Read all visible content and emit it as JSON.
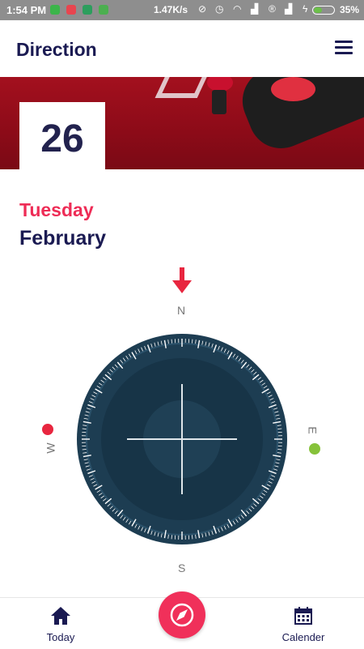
{
  "status_bar": {
    "time": "1:54 PM",
    "speed": "1.47K/s",
    "battery_percent": "35%"
  },
  "app_bar": {
    "title": "Direction",
    "menu_icon": "hamburger-menu-icon"
  },
  "date": {
    "day_number": "26",
    "weekday": "Tuesday",
    "month": "February"
  },
  "compass": {
    "north": "N",
    "south": "S",
    "east": "E",
    "west": "W",
    "colors": {
      "arrow": "#e8263f",
      "west_dot": "#e8263f",
      "east_dot": "#86c23a",
      "dial": "#1d3d52",
      "dial_inner": "#183345"
    }
  },
  "bottom_nav": {
    "today_label": "Today",
    "calendar_label": "Calender",
    "fab_icon": "compass-icon"
  },
  "colors": {
    "accent": "#ee2c56",
    "primary_text": "#1a1a52"
  }
}
